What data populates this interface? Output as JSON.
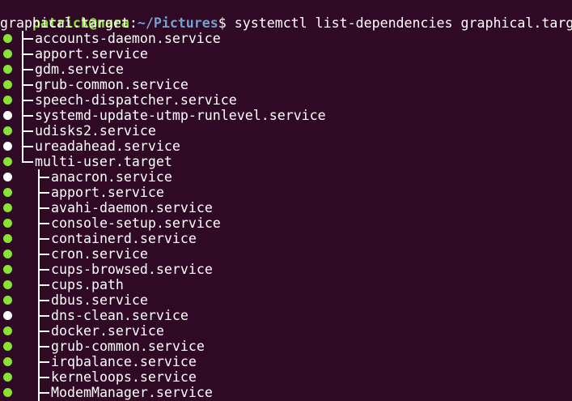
{
  "prompt": {
    "user_host": "patrick@nara",
    "separator": ":",
    "path": "~/Pictures",
    "symbol": "$ ",
    "command": "systemctl list-dependencies graphical.target"
  },
  "root_unit": "graphical.target",
  "colors": {
    "background": "#300a24",
    "active_dot": "#8ae234",
    "inactive_dot": "#ffffff",
    "prompt_user": "#8ae234",
    "prompt_path": "#729fcf"
  },
  "units": [
    {
      "name": "accounts-daemon.service",
      "state": "active",
      "depth": 1
    },
    {
      "name": "apport.service",
      "state": "active",
      "depth": 1
    },
    {
      "name": "gdm.service",
      "state": "active",
      "depth": 1
    },
    {
      "name": "grub-common.service",
      "state": "active",
      "depth": 1
    },
    {
      "name": "speech-dispatcher.service",
      "state": "active",
      "depth": 1
    },
    {
      "name": "systemd-update-utmp-runlevel.service",
      "state": "inactive",
      "depth": 1
    },
    {
      "name": "udisks2.service",
      "state": "active",
      "depth": 1
    },
    {
      "name": "ureadahead.service",
      "state": "inactive",
      "depth": 1
    },
    {
      "name": "multi-user.target",
      "state": "active",
      "depth": 1
    },
    {
      "name": "anacron.service",
      "state": "inactive",
      "depth": 2
    },
    {
      "name": "apport.service",
      "state": "active",
      "depth": 2
    },
    {
      "name": "avahi-daemon.service",
      "state": "active",
      "depth": 2
    },
    {
      "name": "console-setup.service",
      "state": "active",
      "depth": 2
    },
    {
      "name": "containerd.service",
      "state": "active",
      "depth": 2
    },
    {
      "name": "cron.service",
      "state": "active",
      "depth": 2
    },
    {
      "name": "cups-browsed.service",
      "state": "active",
      "depth": 2
    },
    {
      "name": "cups.path",
      "state": "active",
      "depth": 2
    },
    {
      "name": "dbus.service",
      "state": "active",
      "depth": 2
    },
    {
      "name": "dns-clean.service",
      "state": "inactive",
      "depth": 2
    },
    {
      "name": "docker.service",
      "state": "active",
      "depth": 2
    },
    {
      "name": "grub-common.service",
      "state": "active",
      "depth": 2
    },
    {
      "name": "irqbalance.service",
      "state": "active",
      "depth": 2
    },
    {
      "name": "kerneloops.service",
      "state": "active",
      "depth": 2
    },
    {
      "name": "ModemManager.service",
      "state": "active",
      "depth": 2
    }
  ]
}
